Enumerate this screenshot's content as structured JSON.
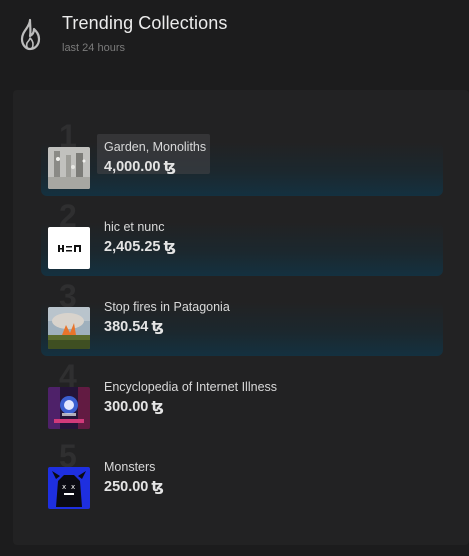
{
  "header": {
    "title": "Trending Collections",
    "subtitle": "last 24 hours",
    "icon": "flame-icon"
  },
  "currency_symbol": "ꜩ",
  "collections": [
    {
      "rank": "1",
      "name": "Garden, Monoliths",
      "price": "4,000.00"
    },
    {
      "rank": "2",
      "name": "hic et nunc",
      "price": "2,405.25"
    },
    {
      "rank": "3",
      "name": "Stop fires in Patagonia",
      "price": "380.54"
    },
    {
      "rank": "4",
      "name": "Encyclopedia of Internet Illness",
      "price": "300.00"
    },
    {
      "rank": "5",
      "name": "Monsters",
      "price": "250.00"
    }
  ],
  "colors": {
    "background": "#1c1c1d",
    "panel": "#222223",
    "row_glow": "#143140"
  }
}
